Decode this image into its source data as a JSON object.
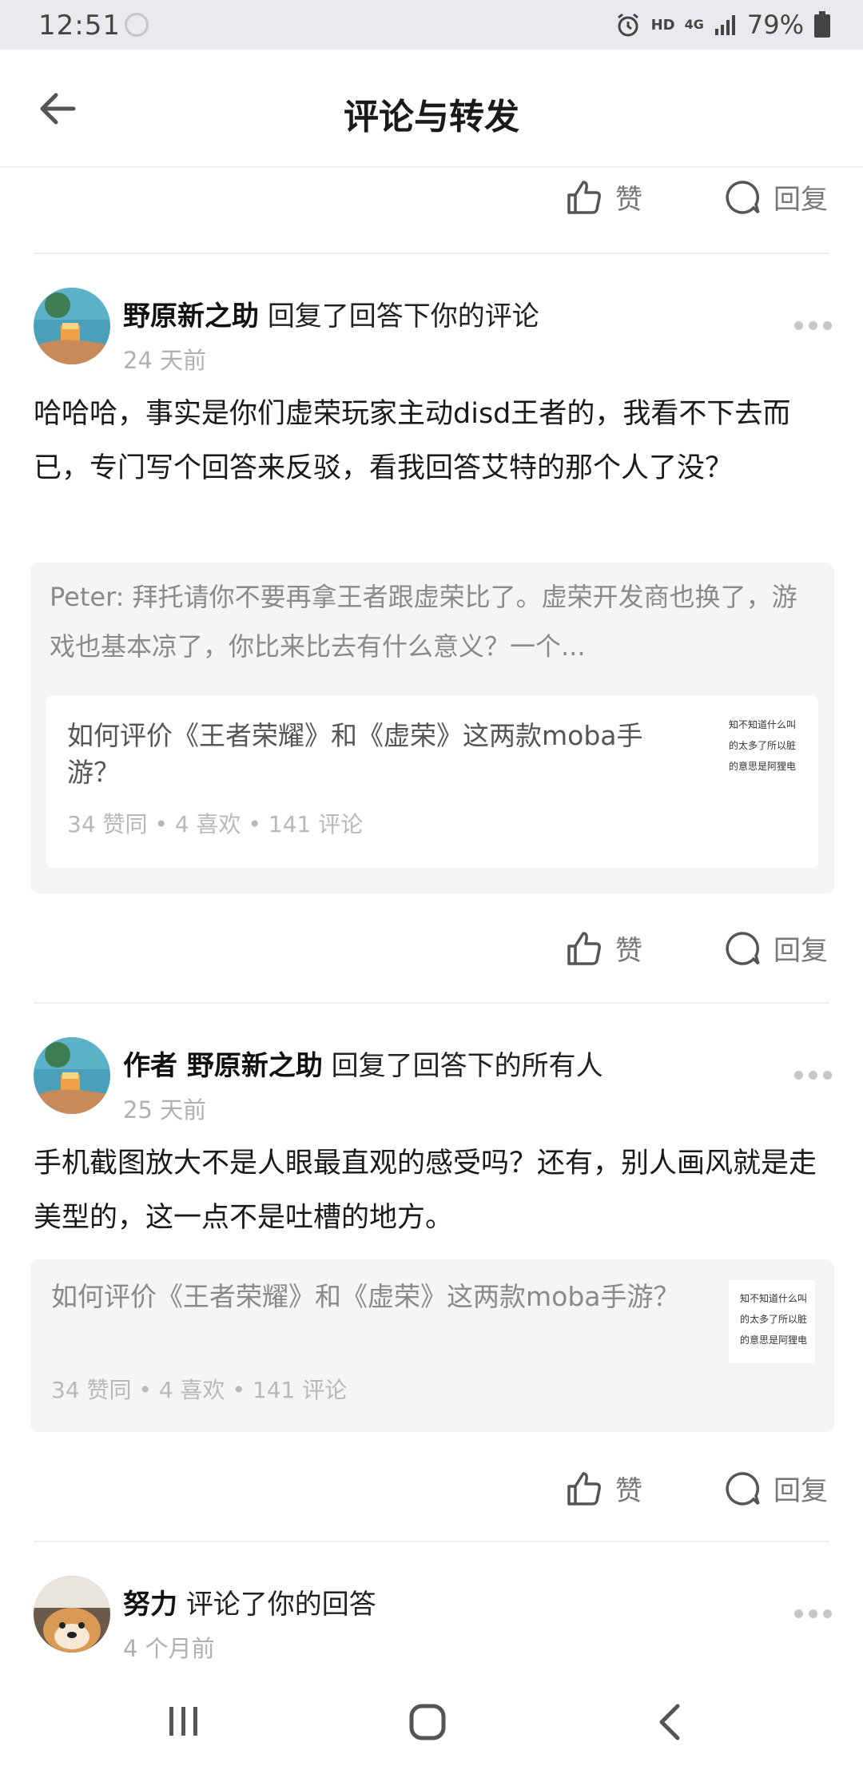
{
  "status_bar": {
    "time": "12:51",
    "hd": "HD",
    "network": "4G",
    "battery": "79%"
  },
  "header": {
    "title": "评论与转发"
  },
  "actions": {
    "like": "赞",
    "reply": "回复"
  },
  "items": [
    {
      "user": "野原新之助",
      "action": "回复了回答下你的评论",
      "time": "24 天前",
      "content": "哈哈哈，事实是你们虚荣玩家主动disd王者的，我看不下去而已，专门写个回答来反驳，看我回答艾特的那个人了没？",
      "quote": "Peter: 拜托请你不要再拿王者跟虚荣比了。虚荣开发商也换了，游戏也基本凉了，你比来比去有什么意义？一个...",
      "card_title": "如何评价《王者荣耀》和《虚荣》这两款moba手游？",
      "card_meta": "34 赞同  •  4 喜欢  •  141 评论",
      "thumb": [
        "知不知道什么叫",
        "的太多了所以脏",
        "的意思是阿狸电"
      ]
    },
    {
      "user": "作者 野原新之助",
      "action": "回复了回答下的所有人",
      "time": "25 天前",
      "content": "手机截图放大不是人眼最直观的感受吗？还有，别人画风就是走美型的，这一点不是吐槽的地方。",
      "card_title": "如何评价《王者荣耀》和《虚荣》这两款moba手游？",
      "card_meta": "34 赞同  •  4 喜欢  •  141 评论",
      "thumb": [
        "知不知道什么叫",
        "的太多了所以脏",
        "的意思是阿狸电"
      ]
    },
    {
      "user": "努力",
      "action": "评论了你的回答",
      "time": "4 个月前"
    }
  ],
  "colors": {
    "text": "#1a1a1a",
    "muted": "#8a8a8a",
    "quote_bg": "#f5f5f5",
    "status_bg": "#e8eaed"
  }
}
